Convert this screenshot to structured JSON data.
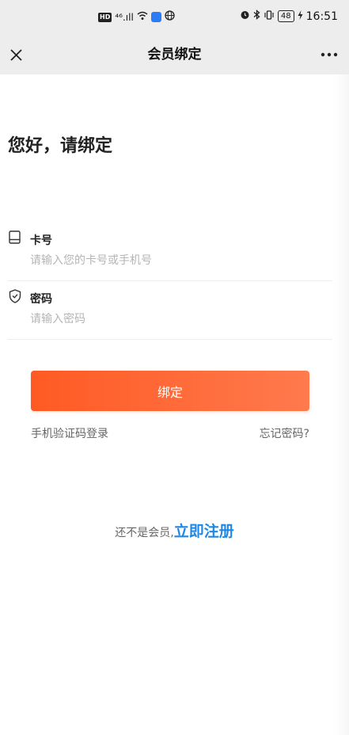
{
  "status_bar": {
    "left_hd": "HD",
    "left_signal": "⁴⁶.ıll",
    "right_battery": "48",
    "right_time": "16:51"
  },
  "nav": {
    "title": "会员绑定",
    "close_icon": "close-icon",
    "more_icon": "more-icon"
  },
  "greeting": "您好，请绑定",
  "card_field": {
    "label": "卡号",
    "placeholder": "请输入您的卡号或手机号",
    "value": "",
    "icon": "card-icon"
  },
  "password_field": {
    "label": "密码",
    "placeholder": "请输入密码",
    "value": "",
    "icon": "shield-icon"
  },
  "bind_button": "绑定",
  "sms_login": "手机验证码登录",
  "forgot_password": "忘记密码?",
  "register": {
    "prompt": "还不是会员,",
    "link": "立即注册"
  },
  "colors": {
    "accent": "#ff6333",
    "link": "#1e88e5",
    "nav_bg": "#ededed"
  }
}
